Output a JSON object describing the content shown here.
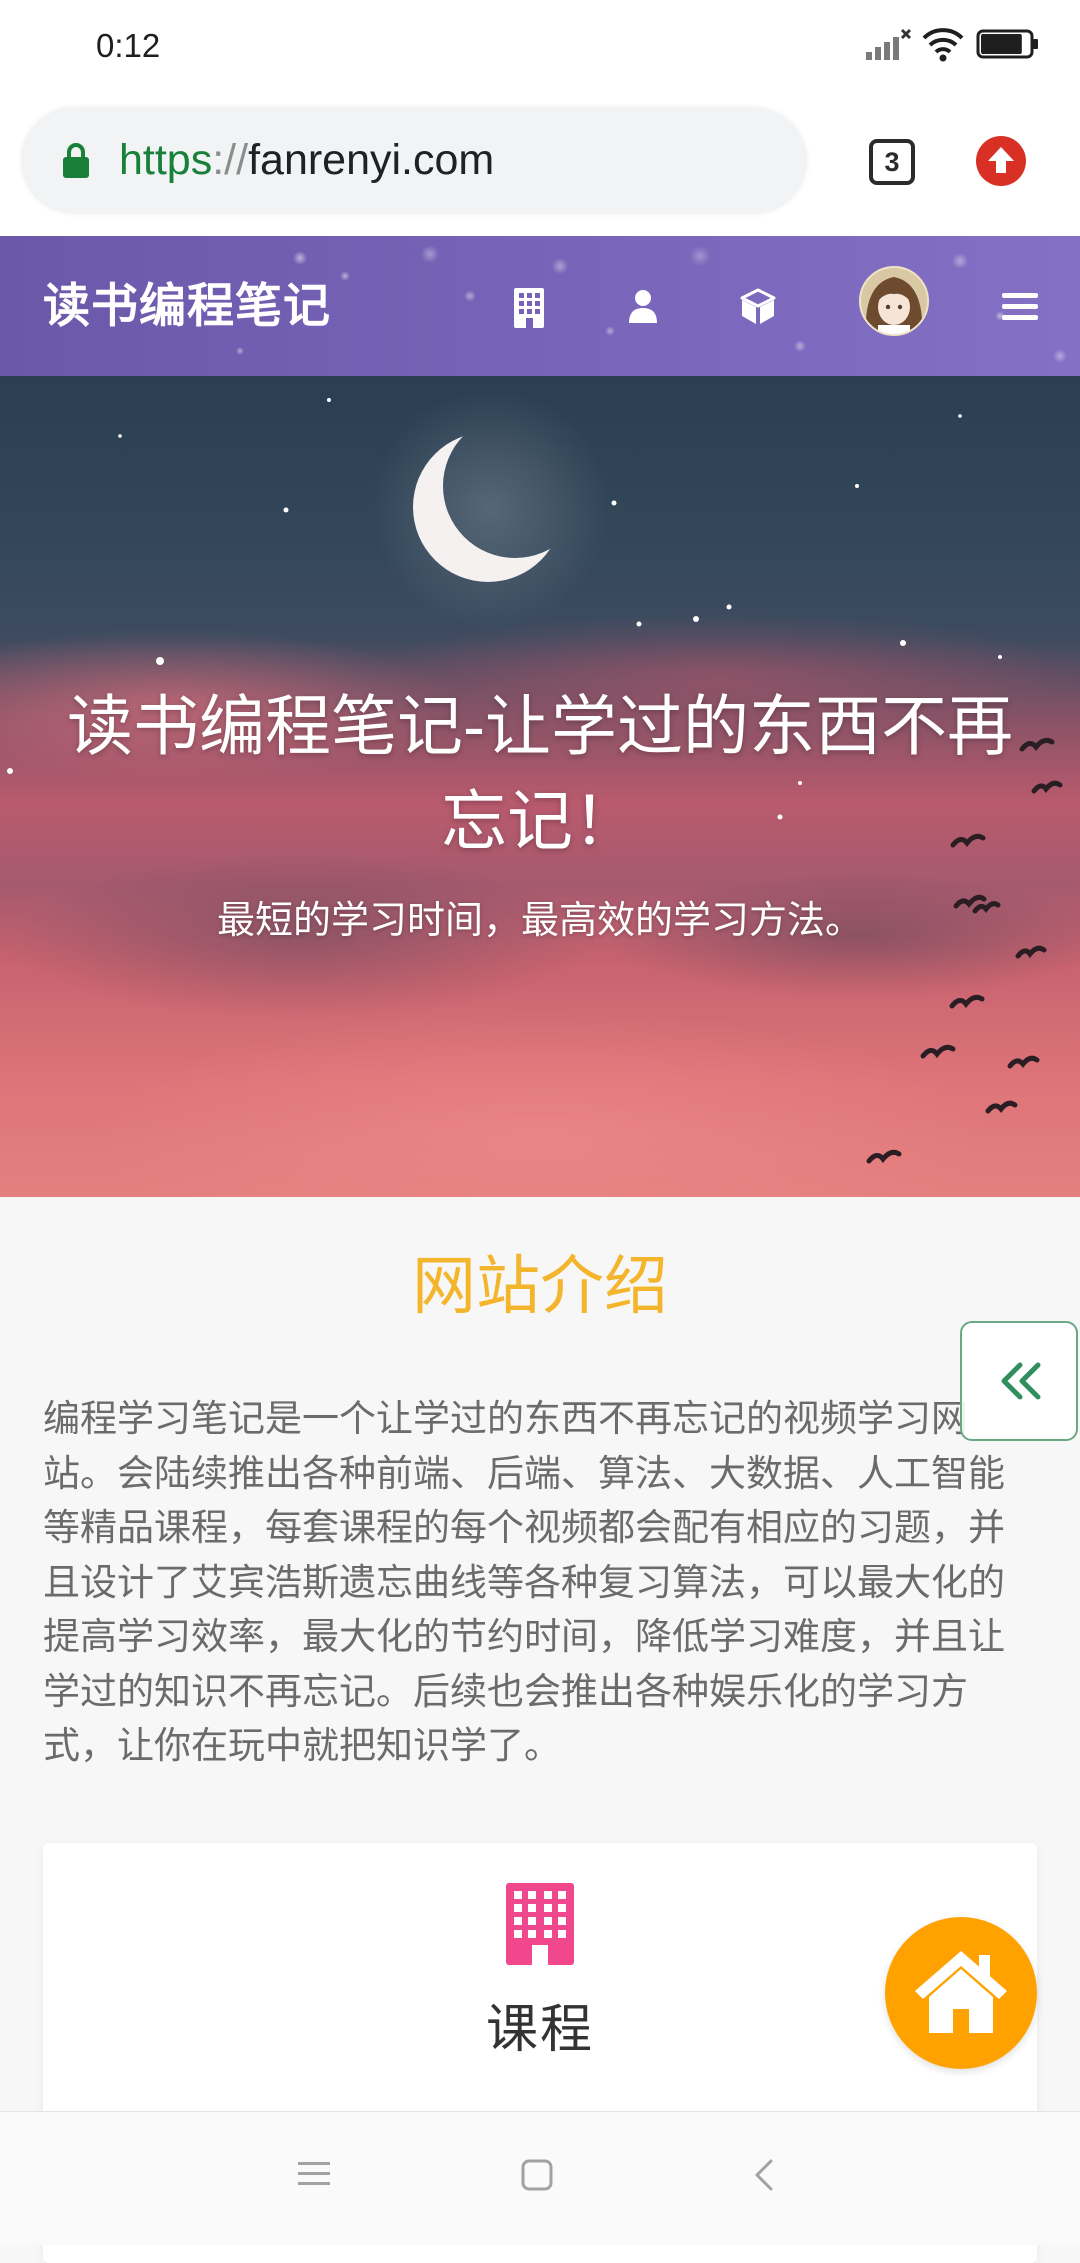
{
  "status_bar": {
    "time": "0:12",
    "signal_icon": "signal-no-service-icon",
    "wifi_icon": "wifi-icon",
    "battery_icon": "battery-icon",
    "battery_level": 0.85
  },
  "browser": {
    "url": {
      "scheme": "https",
      "separator": "://",
      "host": "fanrenyi.com"
    },
    "lock_icon": "lock-icon",
    "tab_count": "3",
    "update_icon": "upload-arrow-icon",
    "colors": {
      "secure": "#188038",
      "update": "#d93025"
    }
  },
  "navbar": {
    "title": "读书编程笔记",
    "icons": [
      "building-icon",
      "user-icon",
      "cube-icon",
      "avatar",
      "menu-icon"
    ],
    "color": "#7663b7"
  },
  "hero": {
    "title": "读书编程笔记-让学过的东西不再忘记！",
    "subtitle": "最短的学习时间，最高效的学习方法。",
    "decorations": [
      "moon-icon",
      "stars",
      "bird-silhouettes"
    ]
  },
  "intro": {
    "heading": "网站介绍",
    "heading_color": "#f3b52c",
    "paragraph_lines": [
      "编程学习笔记是一个让学过的东西不再忘记的视频学习网",
      "站。会陆续推出各种前端、后端、算法、大数据、人工智能",
      "等精品课程，每套课程的每个视频都会配有相应的习题，并",
      "且设计了艾宾浩斯遗忘曲线等各种复习算法，可以最大化的",
      "提高学习效率，最大化的节约时间，降低学习难度，并且让",
      "学过的知识不再忘记。后续也会推出各种娱乐化的学习方",
      "式，让你在玩中就把知识学了。"
    ]
  },
  "feature_card": {
    "icon": "building-icon",
    "icon_color": "#f0478d",
    "title": "课程"
  },
  "floating": {
    "collapse_icon": "double-chevron-left-icon",
    "collapse_color": "#2f8f5f",
    "home_icon": "home-icon",
    "home_color": "#ffa200"
  },
  "system_nav": {
    "icons": [
      "menu-icon",
      "home-square-icon",
      "back-icon"
    ]
  }
}
